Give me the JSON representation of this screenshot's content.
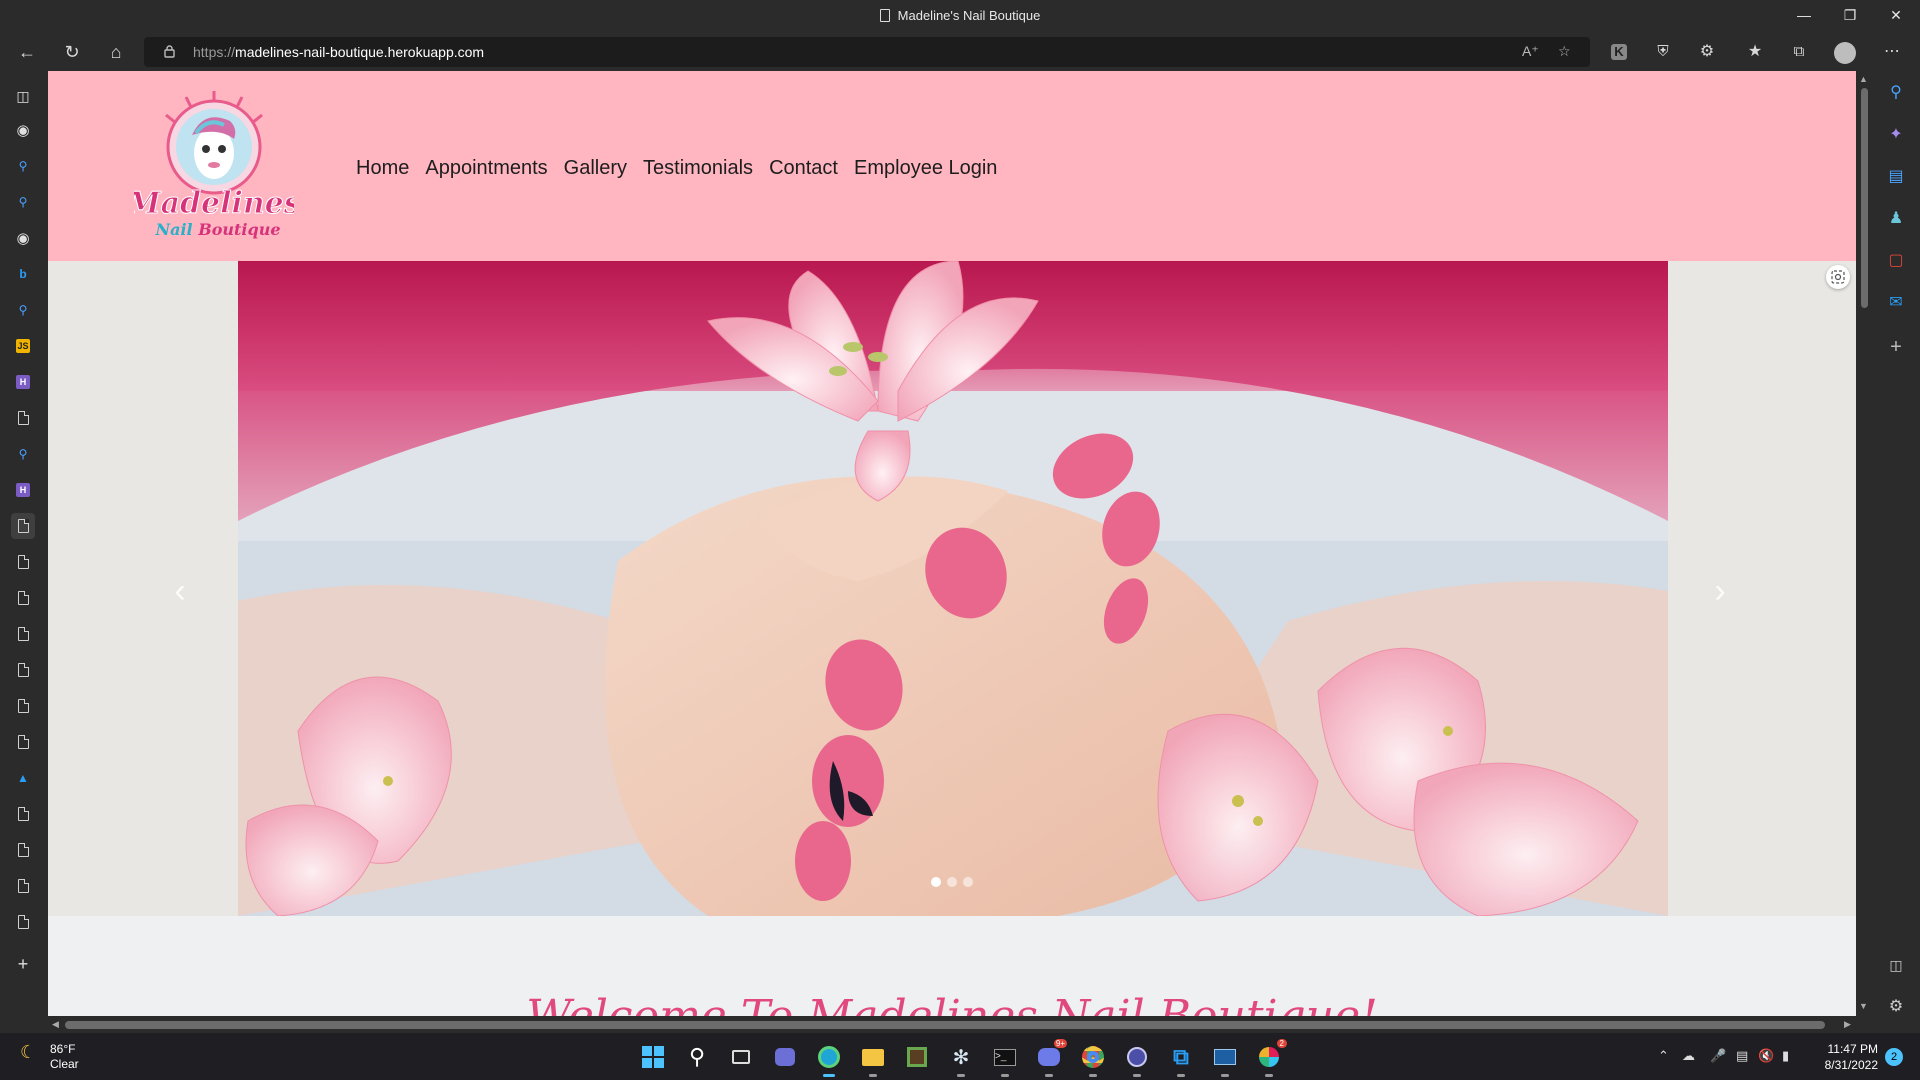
{
  "window": {
    "title": "Madeline's Nail Boutique"
  },
  "address_bar": {
    "protocol": "https://",
    "host": "madelines-nail-boutique.herokuapp.com"
  },
  "site": {
    "logo_alt": "Madelines Nail Boutique",
    "nav": [
      "Home",
      "Appointments",
      "Gallery",
      "Testimonials",
      "Contact",
      "Employee Login"
    ],
    "welcome_heading": "Welcome To Madelines Nail Boutique!"
  },
  "carousel": {
    "slide_count": 3,
    "active_index": 0
  },
  "taskbar": {
    "weather_temp": "86°F",
    "weather_desc": "Clear",
    "time": "11:47 PM",
    "date": "8/31/2022",
    "notification_count": "2",
    "discord_badge": "9+",
    "slack_badge": "2"
  },
  "colors": {
    "header_bg": "#ffb6c1",
    "accent": "#e0487e"
  }
}
